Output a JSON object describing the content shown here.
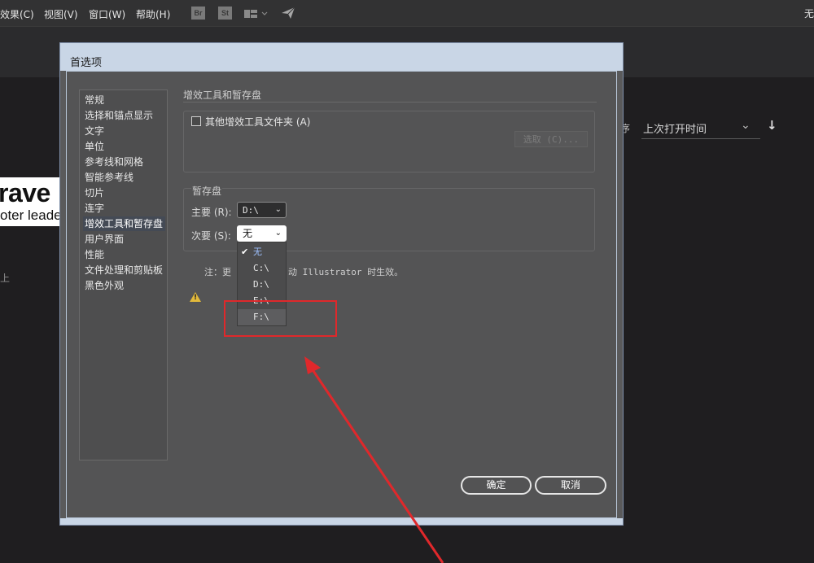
{
  "menubar": {
    "items": [
      "效果(C)",
      "视图(V)",
      "窗口(W)",
      "帮助(H)"
    ],
    "icons": [
      "Br",
      "St"
    ],
    "right_text": "无"
  },
  "background": {
    "card_title": "rave",
    "card_subtitle": "oter leade",
    "side_text": "上",
    "sort_label": "序",
    "sort_value": "上次打开时间"
  },
  "dialog": {
    "title": "首选项",
    "nav_items": [
      "常规",
      "选择和锚点显示",
      "文字",
      "单位",
      "参考线和网格",
      "智能参考线",
      "切片",
      "连字",
      "增效工具和暂存盘",
      "用户界面",
      "性能",
      "文件处理和剪贴板",
      "黑色外观"
    ],
    "active_nav_index": 8,
    "plugins": {
      "section_title": "增效工具和暂存盘",
      "checkbox_label": "其他增效工具文件夹 (A)",
      "choose_button": "选取 (C)..."
    },
    "scratch": {
      "section_title": "暂存盘",
      "primary_label": "主要 (R):",
      "primary_value": "D:\\",
      "secondary_label": "次要 (S):",
      "secondary_value": "无",
      "options": [
        "无",
        "C:\\",
        "D:\\",
        "E:\\",
        "F:\\"
      ],
      "checked_option": "无",
      "hover_option": "F:\\"
    },
    "note": {
      "prefix": "注：更",
      "suffix": "动 Illustrator 时生效。"
    },
    "ok_button": "确定",
    "cancel_button": "取消"
  },
  "colors": {
    "annotation": "#e0282b",
    "dialog_title_bar": "#c9d6e6",
    "dialog_body": "#545455"
  }
}
